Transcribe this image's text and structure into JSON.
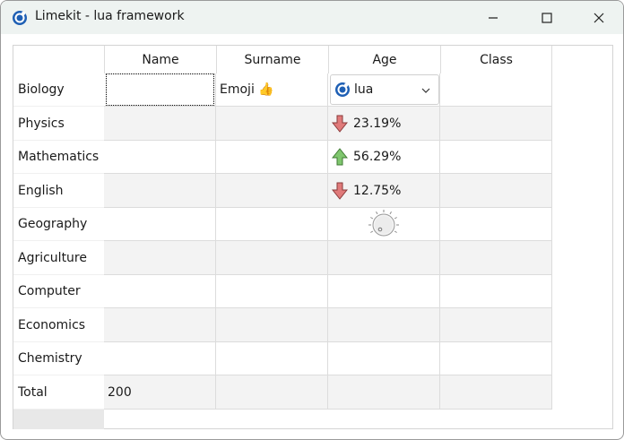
{
  "window": {
    "title": "Limekit - lua framework",
    "icon": "limekit-app-icon",
    "controls": [
      "minimize-icon",
      "maximize-icon",
      "close-icon"
    ]
  },
  "table": {
    "columns": [
      "Name",
      "Surname",
      "Age",
      "Class"
    ],
    "rows": [
      "Biology",
      "Physics",
      "Mathematics",
      "English",
      "Geography",
      "Agriculture",
      "Computer",
      "Economics",
      "Chemistry",
      "Total"
    ],
    "biology": {
      "name_value": "",
      "surname_value": "Emoji 👍",
      "age_combo_selected": "lua",
      "age_combo_icon": "limekit-app-icon"
    },
    "physics": {
      "age_change": "23.19%",
      "direction": "down",
      "icon": "arrow-down-icon"
    },
    "mathematics": {
      "age_change": "56.29%",
      "direction": "up",
      "icon": "arrow-up-icon"
    },
    "english": {
      "age_change": "12.75%",
      "direction": "down",
      "icon": "arrow-down-icon"
    },
    "geography": {
      "age_widget": "dial-icon"
    },
    "total": {
      "name_value": "200"
    }
  },
  "colors": {
    "arrow_down": "#e07a7a",
    "arrow_up": "#7fc66e",
    "row_alt": "#f3f3f3",
    "titlebar": "#eef3f1"
  }
}
